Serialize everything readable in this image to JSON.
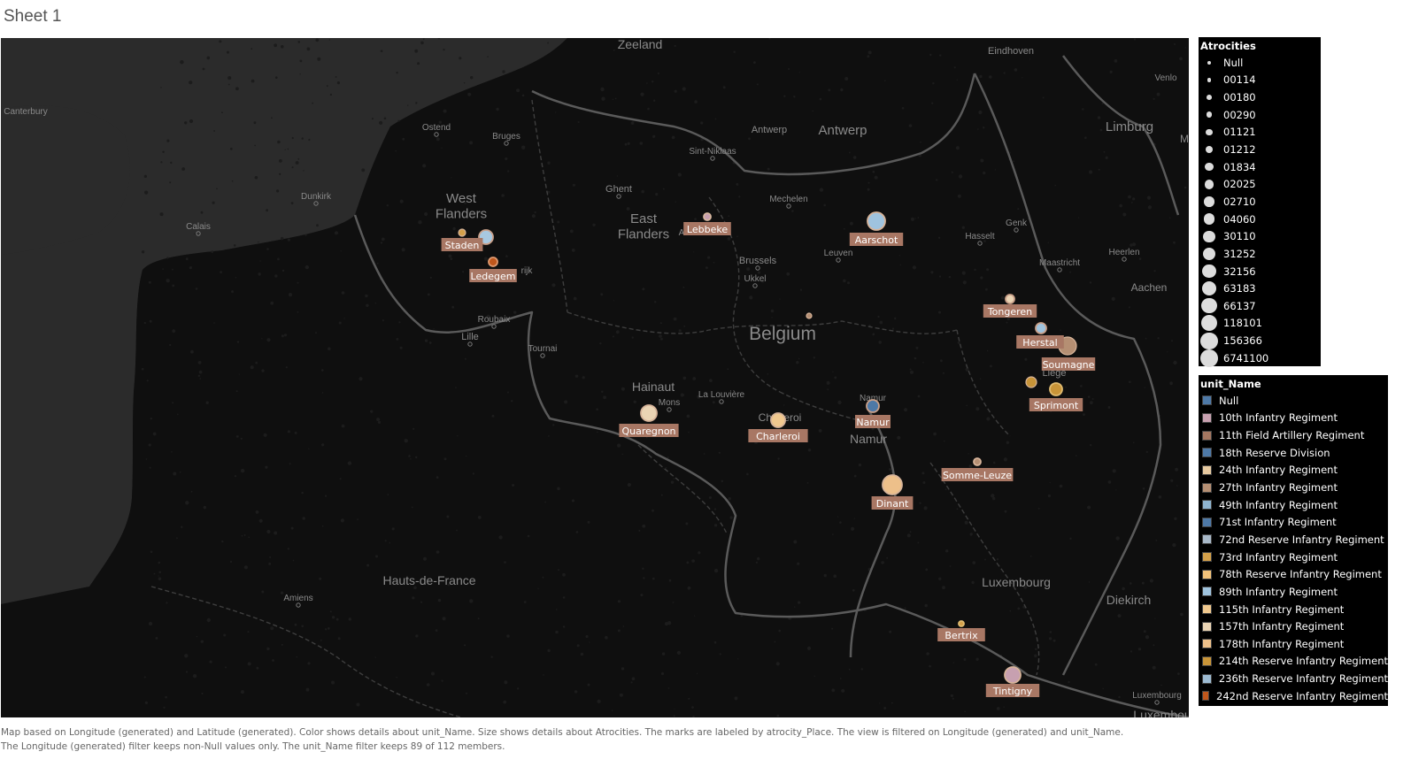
{
  "sheet": {
    "title": "Sheet 1"
  },
  "map_labels": {
    "zeeland": "Zeeland",
    "eindhoven": "Eindhoven",
    "venlo": "Venlo",
    "canterbury": "Canterbury",
    "ostend": "Ostend",
    "bruges": "Bruges",
    "antwerp_city": "Antwerp",
    "antwerp_prov": "Antwerp",
    "limburg": "Limburg",
    "sint_niklaas": "Sint-Niklaas",
    "west_flanders": "West\nFlanders",
    "ghent": "Ghent",
    "dunkirk": "Dunkirk",
    "mechelen": "Mechelen",
    "calais": "Calais",
    "east_flanders": "East\nFlanders",
    "genk": "Genk",
    "hasselt": "Hasselt",
    "leuven": "Leuven",
    "heerlen": "Heerlen",
    "maastricht": "Maastricht",
    "brussels": "Brussels",
    "ukkel": "Ukkel",
    "aachen": "Aachen",
    "roubaix": "Roubaix",
    "lille": "Lille",
    "belgium": "Belgium",
    "tournai": "Tournai",
    "hainaut": "Hainaut",
    "la_louviere": "La Louvière",
    "mons": "Mons",
    "namur_city": "Namur",
    "namur_prov": "Namur",
    "liege_part": "Liège",
    "hauts_de_france": "Hauts-de-France",
    "amiens": "Amiens",
    "luxembourg_prov": "Luxembourg",
    "diekirch": "Diekirch",
    "luxembourg_city": "Luxembourg",
    "luxembourg_cut": "Luxembou",
    "kortrijk_part": "rijk",
    "charleroi_base": "Charleroi",
    "m_cut": "M",
    "a_cut": "A"
  },
  "marks": [
    {
      "place": "Staden",
      "label": "Staden"
    },
    {
      "place": "Ledegem",
      "label": "Ledegem"
    },
    {
      "place": "Lebbeke",
      "label": "Lebbeke"
    },
    {
      "place": "Aarschot",
      "label": "Aarschot"
    },
    {
      "place": "Tongeren",
      "label": "Tongeren"
    },
    {
      "place": "Herstal",
      "label": "Herstal"
    },
    {
      "place": "Soumagne",
      "label": "Soumagne"
    },
    {
      "place": "Sprimont",
      "label": "Sprimont"
    },
    {
      "place": "Quaregnon",
      "label": "Quaregnon"
    },
    {
      "place": "Charleroi",
      "label": "Charleroi"
    },
    {
      "place": "Namur",
      "label": "Namur"
    },
    {
      "place": "Somme-Leuze",
      "label": "Somme-Leuze"
    },
    {
      "place": "Dinant",
      "label": "Dinant"
    },
    {
      "place": "Bertrix",
      "label": "Bertrix"
    },
    {
      "place": "Tintigny",
      "label": "Tintigny"
    }
  ],
  "legend_size": {
    "title": "Atrocities",
    "items": [
      "Null",
      "00114",
      "00180",
      "00290",
      "01121",
      "01212",
      "01834",
      "02025",
      "02710",
      "04060",
      "30110",
      "31252",
      "32156",
      "63183",
      "66137",
      "118101",
      "156366",
      "6741100"
    ]
  },
  "legend_color": {
    "title": "unit_Name",
    "items": [
      {
        "label": "Null",
        "color": "#4e79a7"
      },
      {
        "label": "10th Infantry Regiment",
        "color": "#c7a0b0"
      },
      {
        "label": "11th Field Artillery Regiment",
        "color": "#a47761"
      },
      {
        "label": "18th Reserve Division",
        "color": "#4e79a7"
      },
      {
        "label": "24th Infantry Regiment",
        "color": "#e6c9a0"
      },
      {
        "label": "27th Infantry Regiment",
        "color": "#b58f73"
      },
      {
        "label": "49th Infantry Regiment",
        "color": "#8fb4d0"
      },
      {
        "label": "71st Infantry Regiment",
        "color": "#4e79a7"
      },
      {
        "label": "72nd Reserve Infantry Regiment",
        "color": "#a8b8c8"
      },
      {
        "label": "73rd Infantry Regiment",
        "color": "#d4a04a"
      },
      {
        "label": "78th Reserve Infantry Regiment",
        "color": "#f2c27a"
      },
      {
        "label": "89th Infantry Regiment",
        "color": "#9fc3de"
      },
      {
        "label": "115th Infantry Regiment",
        "color": "#f0c88e"
      },
      {
        "label": "157th Infantry Regiment",
        "color": "#ead4b4"
      },
      {
        "label": "178th Infantry Regiment",
        "color": "#edc08a"
      },
      {
        "label": "214th Reserve Infantry Regiment",
        "color": "#c89438"
      },
      {
        "label": "236th Reserve Infantry Regiment",
        "color": "#9cbad1"
      },
      {
        "label": "242nd Reserve Infantry Regiment",
        "color": "#c0571c"
      }
    ]
  },
  "caption": {
    "line1": "Map based on Longitude (generated) and Latitude (generated).  Color shows details about unit_Name.  Size shows details about Atrocities.  The marks are labeled by atrocity_Place. The view is filtered on Longitude (generated) and unit_Name.",
    "line2": "The Longitude (generated) filter keeps non-Null values only. The unit_Name filter keeps 89 of 112 members."
  }
}
